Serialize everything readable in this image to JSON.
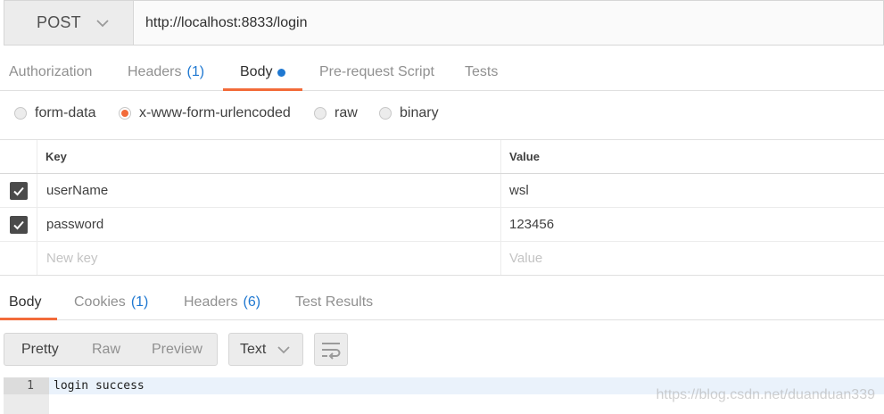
{
  "request": {
    "method": "POST",
    "url": "http://localhost:8833/login"
  },
  "request_tabs": [
    {
      "label": "Authorization",
      "count": ""
    },
    {
      "label": "Headers",
      "count": "(1)"
    },
    {
      "label": "Body",
      "count": ""
    },
    {
      "label": "Pre-request Script",
      "count": ""
    },
    {
      "label": "Tests",
      "count": ""
    }
  ],
  "body_types": [
    "form-data",
    "x-www-form-urlencoded",
    "raw",
    "binary"
  ],
  "kv_table": {
    "headers": {
      "key": "Key",
      "value": "Value"
    },
    "rows": [
      {
        "key": "userName",
        "value": "wsl"
      },
      {
        "key": "password",
        "value": "123456"
      }
    ],
    "placeholder": {
      "key": "New key",
      "value": "Value"
    }
  },
  "response_tabs": [
    {
      "label": "Body",
      "count": ""
    },
    {
      "label": "Cookies",
      "count": "(1)"
    },
    {
      "label": "Headers",
      "count": "(6)"
    },
    {
      "label": "Test Results",
      "count": ""
    }
  ],
  "response_view": {
    "modes": [
      "Pretty",
      "Raw",
      "Preview"
    ],
    "format": "Text"
  },
  "response_body": {
    "line_number": "1",
    "text": "login success"
  },
  "watermark": "https://blog.csdn.net/duanduan339",
  "colors": {
    "accent": "#f26b3a",
    "count_blue": "#1f78d1"
  }
}
